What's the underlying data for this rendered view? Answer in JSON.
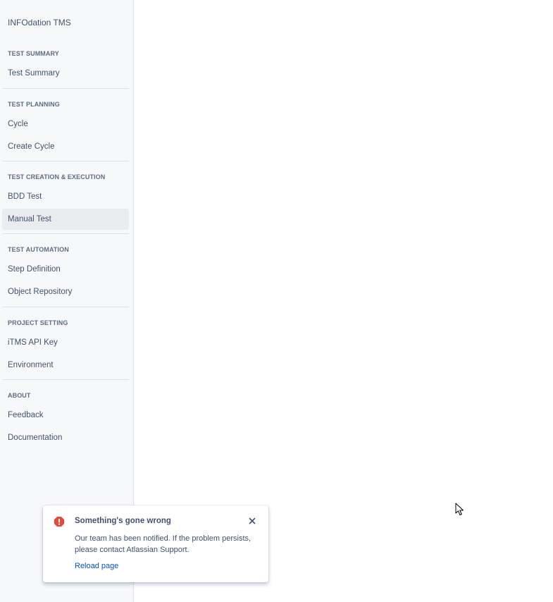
{
  "app": {
    "title": "INFOdation TMS"
  },
  "sidebar": {
    "sections": [
      {
        "header": "TEST SUMMARY",
        "items": [
          {
            "label": "Test Summary"
          }
        ]
      },
      {
        "header": "TEST PLANNING",
        "items": [
          {
            "label": "Cycle"
          },
          {
            "label": "Create Cycle"
          }
        ]
      },
      {
        "header": "TEST CREATION & EXECUTION",
        "items": [
          {
            "label": "BDD Test"
          },
          {
            "label": "Manual Test",
            "active": true
          }
        ]
      },
      {
        "header": "TEST AUTOMATION",
        "items": [
          {
            "label": "Step Definition"
          },
          {
            "label": "Object Repository"
          }
        ]
      },
      {
        "header": "PROJECT SETTING",
        "items": [
          {
            "label": "iTMS API Key"
          },
          {
            "label": "Environment"
          }
        ]
      },
      {
        "header": "ABOUT",
        "items": [
          {
            "label": "Feedback"
          },
          {
            "label": "Documentation"
          }
        ]
      }
    ]
  },
  "error_flag": {
    "icon": "error-icon",
    "title": "Something's gone wrong",
    "message": "Our team has been notified. If the problem persists, please contact Atlassian Support.",
    "action_label": "Reload page",
    "close_icon": "close-icon"
  },
  "colors": {
    "sidebar_bg": "#f7f8f9",
    "active_item_bg": "#ebecf0",
    "error_red": "#e5493a",
    "link_blue": "#0052cc",
    "text": "#42526e",
    "header_text": "#5e6c84"
  }
}
